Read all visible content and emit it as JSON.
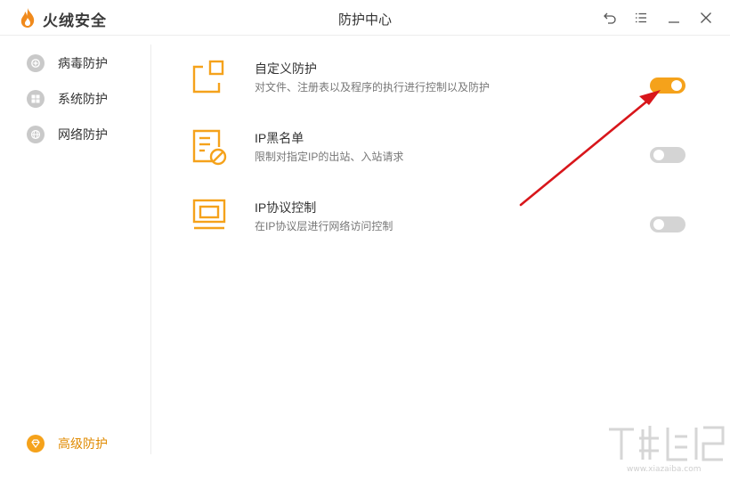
{
  "app": {
    "name": "火绒安全",
    "window_title": "防护中心"
  },
  "window_controls": [
    "back-icon",
    "menu-icon",
    "minimize-icon",
    "close-icon"
  ],
  "sidebar": {
    "items": [
      {
        "label": "病毒防护",
        "icon": "virus-shield-icon",
        "active": false
      },
      {
        "label": "系统防护",
        "icon": "windows-icon",
        "active": false
      },
      {
        "label": "网络防护",
        "icon": "globe-icon",
        "active": false
      }
    ],
    "bottom_item": {
      "label": "高级防护",
      "icon": "diamond-icon",
      "active": true
    }
  },
  "rows": [
    {
      "title": "自定义防护",
      "desc": "对文件、注册表以及程序的执行进行控制以及防护",
      "icon": "custom-protect-icon",
      "enabled": true
    },
    {
      "title": "IP黑名单",
      "desc": "限制对指定IP的出站、入站请求",
      "icon": "ip-blacklist-icon",
      "enabled": false
    },
    {
      "title": "IP协议控制",
      "desc": "在IP协议层进行网络访问控制",
      "icon": "ip-protocol-icon",
      "enabled": false
    }
  ],
  "watermark": {
    "text": "www.xiazaiba.com"
  },
  "colors": {
    "accent": "#f5a21b",
    "arrow": "#d8161b",
    "toggle_off": "#d4d4d4"
  }
}
